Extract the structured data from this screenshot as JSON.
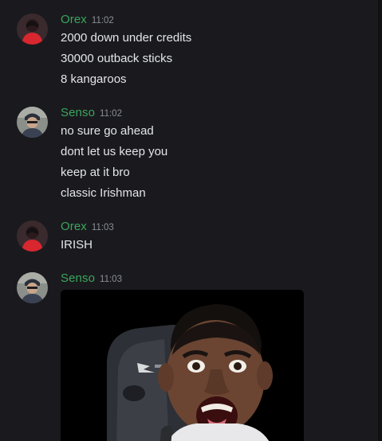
{
  "messages": [
    {
      "author": "Orex",
      "time": "11:02",
      "lines": [
        "2000 down under credits",
        "30000 outback sticks",
        "8 kangaroos"
      ]
    },
    {
      "author": "Senso",
      "time": "11:02",
      "lines": [
        "no sure go ahead",
        "dont let us keep you",
        "keep at it bro",
        "classic Irishman"
      ]
    },
    {
      "author": "Orex",
      "time": "11:03",
      "lines": [
        "IRISH"
      ]
    },
    {
      "author": "Senso",
      "time": "11:03",
      "attachment": "reaction-gif"
    }
  ],
  "colors": {
    "background": "#1a1a1e",
    "username": "#3ba55d",
    "text": "#e3e5e8",
    "timestamp": "#8a8e94"
  }
}
